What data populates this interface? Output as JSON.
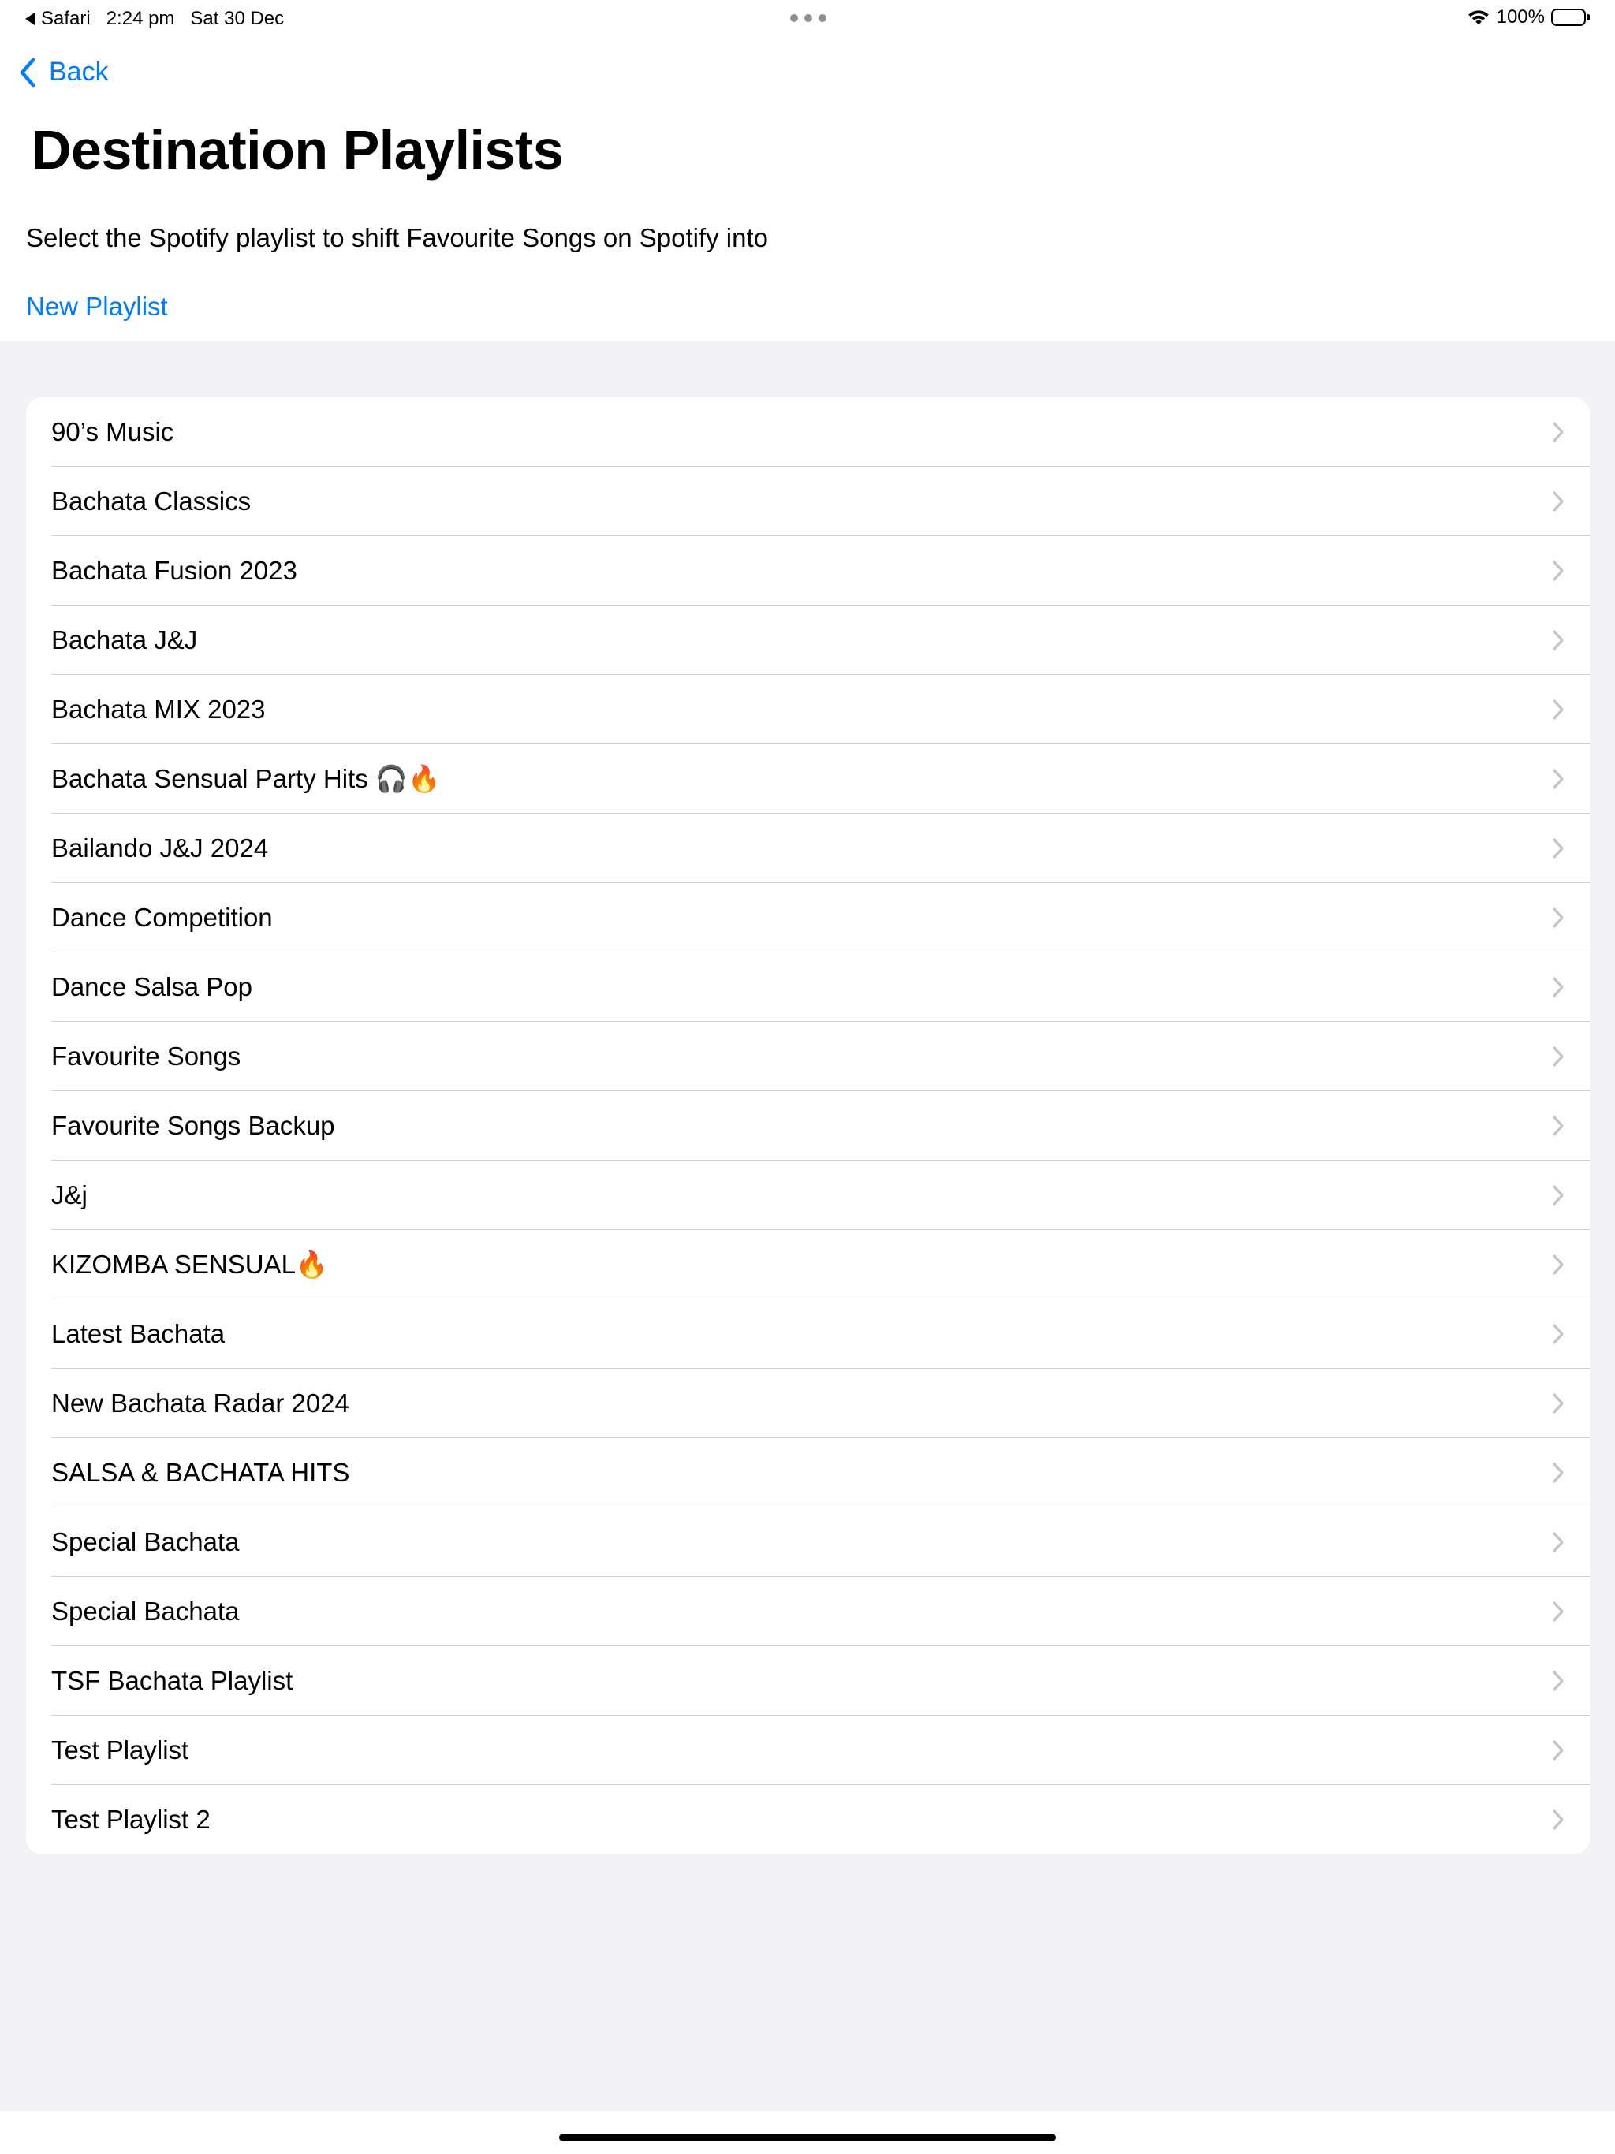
{
  "status_bar": {
    "back_app": "Safari",
    "time": "2:24 pm",
    "date": "Sat 30 Dec",
    "battery": "100%"
  },
  "nav": {
    "back_label": "Back"
  },
  "page": {
    "title": "Destination Playlists",
    "subtitle": "Select the Spotify playlist to shift Favourite Songs on Spotify into",
    "new_playlist_label": "New Playlist"
  },
  "playlists": [
    {
      "label": "90’s Music"
    },
    {
      "label": "Bachata Classics"
    },
    {
      "label": "Bachata Fusion 2023"
    },
    {
      "label": "Bachata J&J"
    },
    {
      "label": "Bachata MIX 2023"
    },
    {
      "label": "Bachata Sensual Party Hits 🎧🔥"
    },
    {
      "label": "Bailando J&J 2024"
    },
    {
      "label": "Dance Competition"
    },
    {
      "label": "Dance Salsa Pop"
    },
    {
      "label": "Favourite Songs"
    },
    {
      "label": "Favourite Songs Backup"
    },
    {
      "label": "J&j"
    },
    {
      "label": "KIZOMBA SENSUAL🔥"
    },
    {
      "label": "Latest Bachata"
    },
    {
      "label": "New Bachata Radar 2024"
    },
    {
      "label": "SALSA & BACHATA HITS"
    },
    {
      "label": "Special Bachata"
    },
    {
      "label": "Special Bachata"
    },
    {
      "label": "TSF Bachata Playlist"
    },
    {
      "label": "Test Playlist"
    },
    {
      "label": "Test Playlist 2"
    }
  ],
  "colors": {
    "accent": "#007aff",
    "background": "#f2f2f7",
    "separator": "#d1d1d6",
    "chevron": "#c4c4c7"
  },
  "icons": {
    "back": "chevron-left-icon",
    "row": "chevron-right-icon",
    "wifi": "wifi-icon",
    "battery": "battery-icon"
  }
}
